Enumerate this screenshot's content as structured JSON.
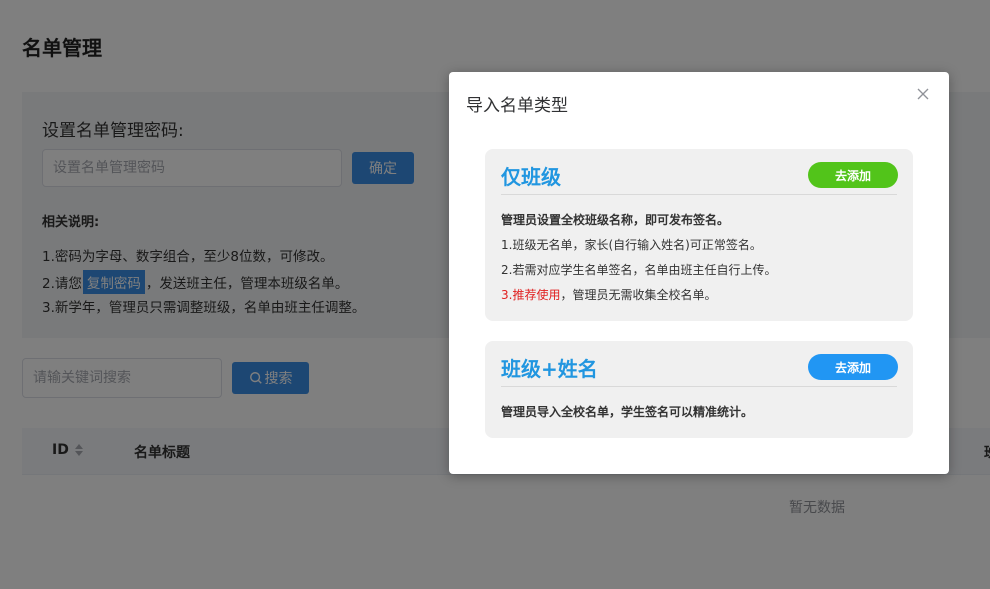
{
  "page": {
    "title": "名单管理"
  },
  "password_panel": {
    "label": "设置名单管理密码:",
    "input_placeholder": "设置名单管理密码",
    "confirm_label": "确定",
    "notes_title": "相关说明:",
    "note_1": "1.密码为字母、数字组合，至少8位数，可修改。",
    "note_2_prefix": "2.请您",
    "note_2_chip": "复制密码",
    "note_2_suffix": "，发送班主任，管理本班级名单。",
    "note_3": "3.新学年，管理员只需调整班级，名单由班主任调整。"
  },
  "search": {
    "placeholder": "请输关键词搜索",
    "button_label": "搜索"
  },
  "table": {
    "columns": [
      "ID",
      "名单标题",
      "班"
    ],
    "empty_text": "暂无数据"
  },
  "dialog": {
    "title": "导入名单类型",
    "cards": [
      {
        "name": "仅班级",
        "add_label": "去添加",
        "lead": "管理员设置全校班级名称，即可发布签名。",
        "lines": [
          "1.班级无名单，家长(自行输入姓名)可正常签名。",
          "2.若需对应学生名单签名，名单由班主任自行上传。"
        ],
        "line3_prefix": "3.",
        "line3_highlight": "推荐使用",
        "line3_suffix": "，管理员无需收集全校名单。"
      },
      {
        "name": "班级+姓名",
        "add_label": "去添加",
        "lead": "管理员导入全校名单，学生签名可以精准统计。"
      }
    ]
  },
  "colors": {
    "primary_blue": "#3a8ee6",
    "card_title_blue": "#2196e0",
    "add_green": "#52c41a",
    "add_blue": "#2196f3",
    "highlight_red": "#e02020"
  },
  "icons": {
    "sort": "sort-icon",
    "search": "search-icon",
    "close": "close-icon"
  }
}
